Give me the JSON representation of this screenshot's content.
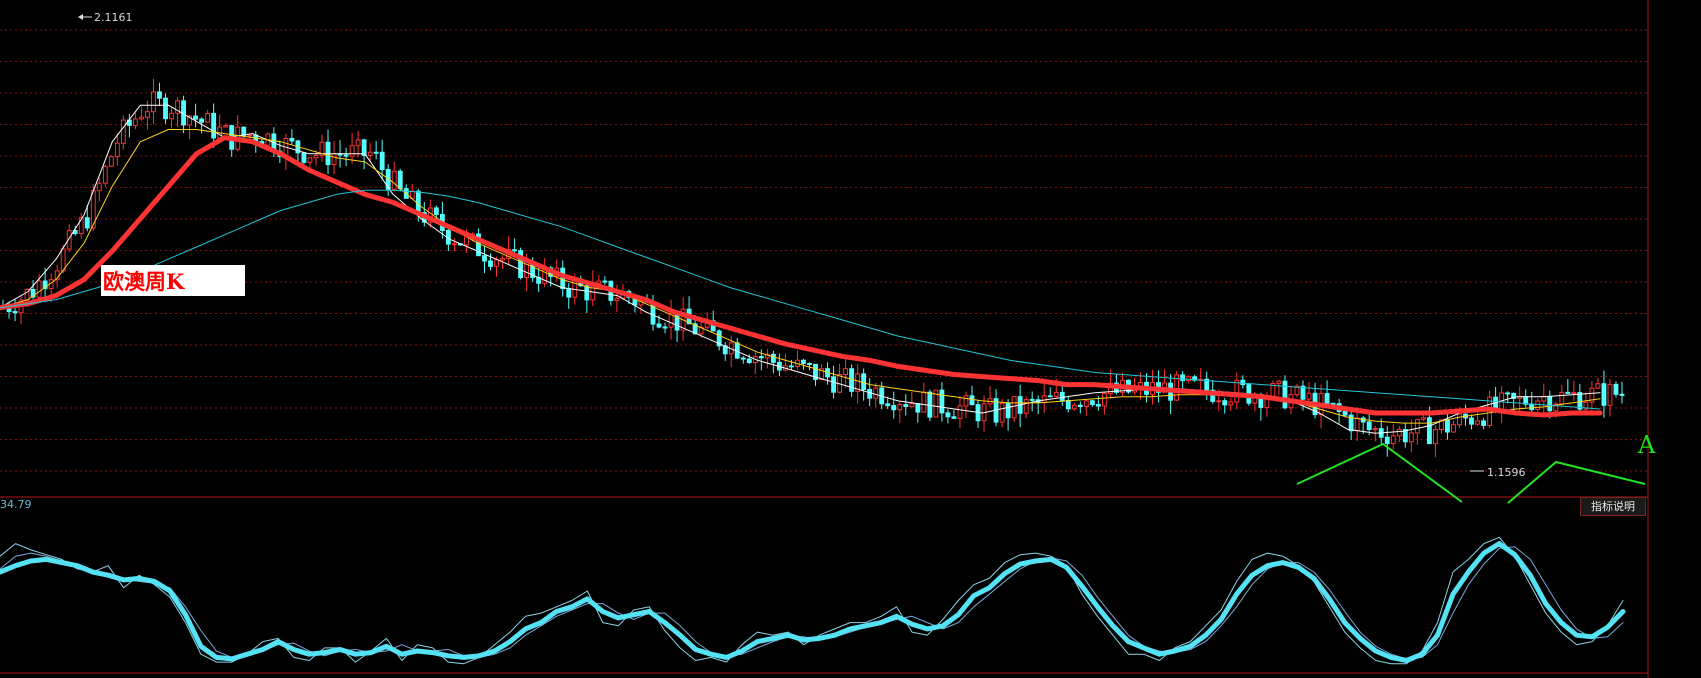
{
  "chart_data": [
    {
      "type": "line",
      "title": "欧澳周K",
      "annotations": {
        "high_label": "2.1161",
        "low_label": "1.1596",
        "pattern_marker": "A"
      },
      "ylim": [
        1.0,
        2.2
      ],
      "grid": "horizontal dashed",
      "series": [
        {
          "color": "#ffffff",
          "values": [
            1.46,
            1.5,
            1.58,
            1.69,
            1.87,
            1.96,
            1.96,
            1.92,
            1.88,
            1.89,
            1.86,
            1.84,
            1.84,
            1.84,
            1.74,
            1.68,
            1.63,
            1.6,
            1.57,
            1.54,
            1.51,
            1.5,
            1.49,
            1.45,
            1.42,
            1.39,
            1.36,
            1.33,
            1.31,
            1.29,
            1.27,
            1.25,
            1.23,
            1.22,
            1.21,
            1.2,
            1.215,
            1.23,
            1.24,
            1.25,
            1.255,
            1.26,
            1.26,
            1.255,
            1.25,
            1.245,
            1.23,
            1.2,
            1.16,
            1.15,
            1.155,
            1.17,
            1.2,
            1.22,
            1.24,
            1.24,
            1.245,
            1.25
          ]
        },
        {
          "color": "#ffd21a",
          "values": [
            1.46,
            1.48,
            1.53,
            1.62,
            1.76,
            1.87,
            1.9,
            1.9,
            1.89,
            1.88,
            1.87,
            1.85,
            1.83,
            1.82,
            1.77,
            1.71,
            1.66,
            1.62,
            1.59,
            1.56,
            1.53,
            1.51,
            1.5,
            1.47,
            1.44,
            1.41,
            1.38,
            1.35,
            1.33,
            1.31,
            1.29,
            1.27,
            1.26,
            1.25,
            1.24,
            1.23,
            1.225,
            1.225,
            1.23,
            1.235,
            1.24,
            1.24,
            1.245,
            1.245,
            1.245,
            1.24,
            1.23,
            1.21,
            1.19,
            1.18,
            1.175,
            1.175,
            1.19,
            1.2,
            1.21,
            1.215,
            1.225,
            1.235
          ]
        },
        {
          "color": "#ff3333",
          "values": [
            1.46,
            1.47,
            1.49,
            1.53,
            1.6,
            1.68,
            1.76,
            1.84,
            1.88,
            1.87,
            1.84,
            1.8,
            1.77,
            1.74,
            1.72,
            1.69,
            1.66,
            1.63,
            1.6,
            1.57,
            1.54,
            1.52,
            1.5,
            1.48,
            1.45,
            1.43,
            1.41,
            1.39,
            1.37,
            1.355,
            1.34,
            1.33,
            1.315,
            1.305,
            1.295,
            1.29,
            1.285,
            1.28,
            1.27,
            1.27,
            1.265,
            1.26,
            1.255,
            1.25,
            1.245,
            1.24,
            1.23,
            1.22,
            1.21,
            1.2,
            1.2,
            1.2,
            1.205,
            1.21,
            1.2,
            1.195,
            1.2,
            1.2
          ]
        },
        {
          "color": "#22c6d8",
          "values": [
            1.46,
            1.47,
            1.48,
            1.5,
            1.52,
            1.55,
            1.58,
            1.61,
            1.64,
            1.67,
            1.7,
            1.72,
            1.74,
            1.75,
            1.75,
            1.745,
            1.735,
            1.72,
            1.7,
            1.68,
            1.66,
            1.635,
            1.61,
            1.585,
            1.56,
            1.535,
            1.51,
            1.49,
            1.47,
            1.45,
            1.43,
            1.41,
            1.39,
            1.375,
            1.36,
            1.345,
            1.33,
            1.32,
            1.31,
            1.3,
            1.295,
            1.29,
            1.285,
            1.28,
            1.275,
            1.27,
            1.265,
            1.26,
            1.255,
            1.25,
            1.245,
            1.24,
            1.235,
            1.23,
            1.225,
            1.22,
            1.215,
            1.21
          ]
        }
      ]
    },
    {
      "type": "line",
      "ylabel": "",
      "readout": "34.79",
      "button_label": "指标说明",
      "ylim": [
        0,
        100
      ],
      "series": [
        {
          "color": "#55e2f4",
          "values": [
            62,
            66,
            69,
            70,
            68,
            66,
            62,
            60,
            57,
            58,
            56,
            50,
            35,
            15,
            8,
            7,
            10,
            13,
            18,
            13,
            10,
            11,
            13,
            10,
            11,
            15,
            10,
            12,
            11,
            9,
            8,
            9,
            12,
            18,
            26,
            30,
            37,
            40,
            45,
            37,
            33,
            35,
            37,
            30,
            22,
            13,
            10,
            8,
            12,
            18,
            20,
            22,
            19,
            20,
            22,
            26,
            28,
            30,
            34,
            29,
            26,
            28,
            35,
            47,
            52,
            61,
            67,
            69,
            70,
            65,
            53,
            40,
            28,
            18,
            14,
            10,
            12,
            15,
            22,
            32,
            48,
            60,
            66,
            68,
            65,
            58,
            45,
            30,
            20,
            12,
            8,
            6,
            10,
            22,
            48,
            62,
            74,
            80,
            73,
            60,
            42,
            30,
            22,
            21,
            27,
            37
          ]
        },
        {
          "color": "#8ad3e8",
          "values": [
            72,
            80,
            76,
            73,
            70,
            64,
            62,
            66,
            52,
            60,
            54,
            46,
            30,
            10,
            5,
            5,
            10,
            18,
            20,
            8,
            6,
            14,
            14,
            5,
            12,
            20,
            6,
            16,
            14,
            5,
            4,
            8,
            16,
            24,
            34,
            36,
            40,
            44,
            50,
            30,
            28,
            38,
            40,
            25,
            14,
            6,
            8,
            5,
            16,
            24,
            22,
            24,
            16,
            22,
            26,
            30,
            30,
            34,
            40,
            24,
            22,
            32,
            44,
            54,
            58,
            68,
            73,
            74,
            72,
            66,
            48,
            34,
            22,
            10,
            10,
            6,
            14,
            18,
            28,
            38,
            56,
            70,
            74,
            72,
            66,
            56,
            40,
            24,
            14,
            6,
            4,
            4,
            12,
            30,
            62,
            70,
            80,
            84,
            72,
            54,
            36,
            24,
            16,
            18,
            28,
            44
          ]
        },
        {
          "color": "#7aa7d8",
          "values": [
            64,
            72,
            74,
            72,
            69,
            66,
            61,
            60,
            58,
            56,
            55,
            52,
            40,
            25,
            12,
            8,
            9,
            12,
            16,
            17,
            12,
            9,
            12,
            13,
            11,
            12,
            16,
            12,
            12,
            13,
            9,
            8,
            10,
            14,
            22,
            28,
            34,
            38,
            42,
            42,
            36,
            32,
            36,
            36,
            28,
            18,
            11,
            9,
            10,
            14,
            18,
            21,
            21,
            19,
            21,
            24,
            27,
            29,
            32,
            34,
            30,
            26,
            30,
            40,
            48,
            56,
            64,
            69,
            71,
            69,
            60,
            46,
            34,
            22,
            15,
            12,
            11,
            13,
            18,
            28,
            40,
            54,
            64,
            68,
            68,
            62,
            51,
            37,
            24,
            15,
            10,
            7,
            8,
            16,
            36,
            54,
            67,
            77,
            78,
            70,
            54,
            38,
            26,
            20,
            21,
            30
          ]
        }
      ]
    }
  ]
}
